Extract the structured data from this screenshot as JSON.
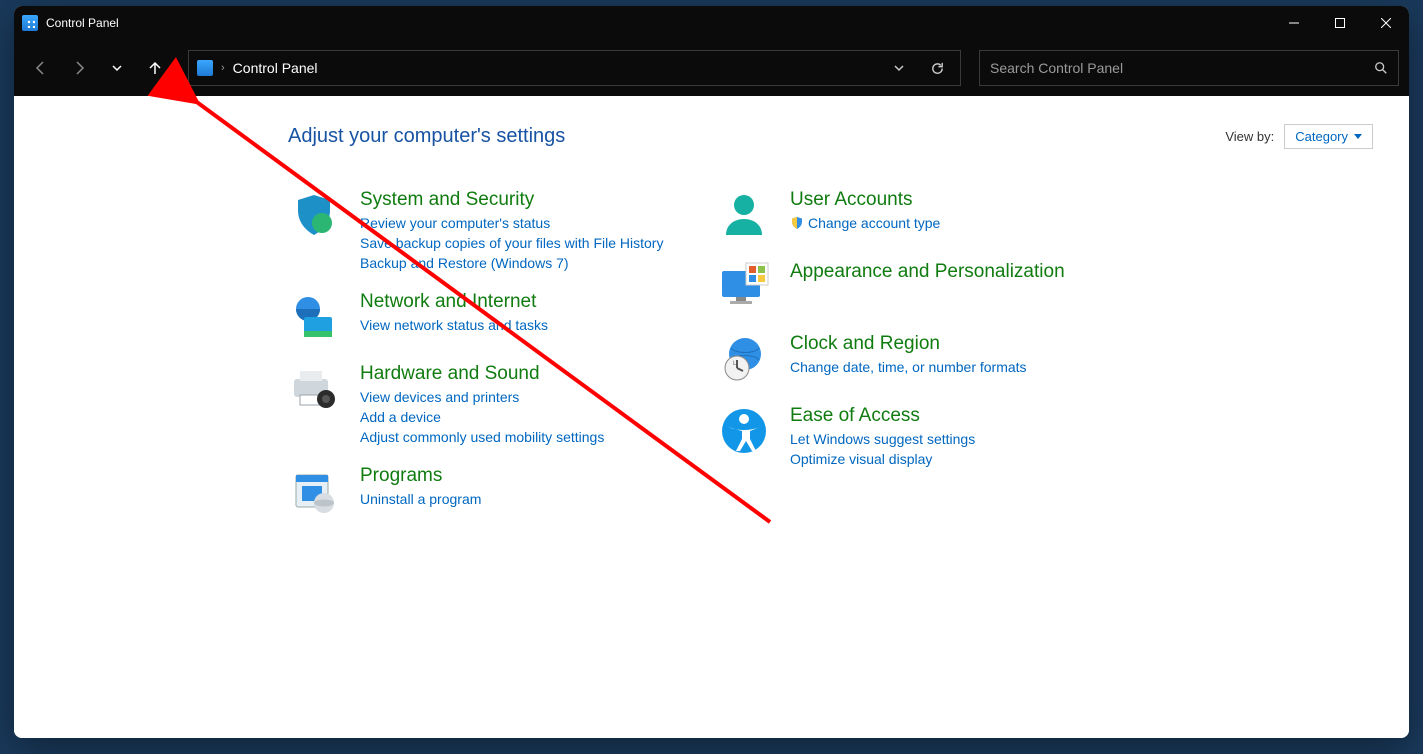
{
  "window": {
    "title": "Control Panel"
  },
  "address": {
    "crumb": "Control Panel"
  },
  "search": {
    "placeholder": "Search Control Panel"
  },
  "header": {
    "title": "Adjust your computer's settings",
    "viewby_label": "View by:",
    "viewby_value": "Category"
  },
  "left": [
    {
      "title": "System and Security",
      "links": [
        "Review your computer's status",
        "Save backup copies of your files with File History",
        "Backup and Restore (Windows 7)"
      ]
    },
    {
      "title": "Network and Internet",
      "links": [
        "View network status and tasks"
      ]
    },
    {
      "title": "Hardware and Sound",
      "links": [
        "View devices and printers",
        "Add a device",
        "Adjust commonly used mobility settings"
      ]
    },
    {
      "title": "Programs",
      "links": [
        "Uninstall a program"
      ]
    }
  ],
  "right": [
    {
      "title": "User Accounts",
      "links": [
        {
          "text": "Change account type",
          "shield": true
        }
      ]
    },
    {
      "title": "Appearance and Personalization",
      "links": []
    },
    {
      "title": "Clock and Region",
      "links": [
        "Change date, time, or number formats"
      ]
    },
    {
      "title": "Ease of Access",
      "links": [
        "Let Windows suggest settings",
        "Optimize visual display"
      ]
    }
  ]
}
